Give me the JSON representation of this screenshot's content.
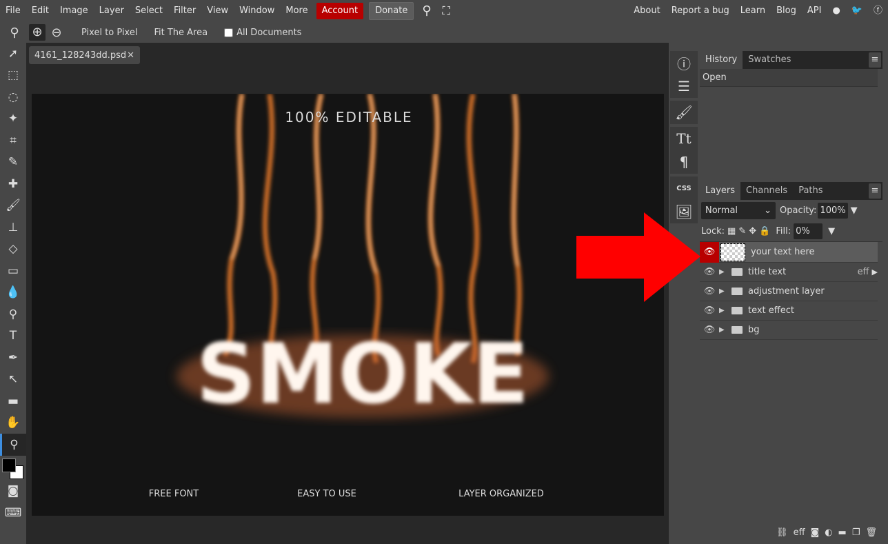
{
  "menu": {
    "items": [
      "File",
      "Edit",
      "Image",
      "Layer",
      "Select",
      "Filter",
      "View",
      "Window",
      "More"
    ],
    "account": "Account",
    "donate": "Donate",
    "right": [
      "About",
      "Report a bug",
      "Learn",
      "Blog",
      "API"
    ],
    "social_icons": [
      "reddit-icon",
      "twitter-icon",
      "facebook-icon"
    ]
  },
  "options": {
    "pixel_to_pixel": "Pixel to Pixel",
    "fit_area": "Fit The Area",
    "all_documents": "All Documents",
    "all_documents_checked": false
  },
  "document": {
    "tab": "4161_128243dd.psd",
    "close": "✕"
  },
  "canvas": {
    "headline": "100% EDITABLE",
    "main_text": "SMOKE",
    "features": [
      "FREE FONT",
      "EASY TO USE",
      "LAYER ORGANIZED"
    ]
  },
  "history": {
    "tabs": [
      "History",
      "Swatches"
    ],
    "items": [
      "Open"
    ]
  },
  "layers": {
    "tabs": [
      "Layers",
      "Channels",
      "Paths"
    ],
    "blend_mode": "Normal",
    "opacity_label": "Opacity:",
    "opacity": "100%",
    "lock_label": "Lock:",
    "fill_label": "Fill:",
    "fill": "0%",
    "items": [
      {
        "name": "your text here",
        "selected": true
      },
      {
        "name": "title text",
        "fx": "eff"
      },
      {
        "name": "adjustment layer"
      },
      {
        "name": "text effect"
      },
      {
        "name": "bg"
      }
    ],
    "footer_fx": "eff"
  },
  "iconcol": {
    "css": "CSS"
  },
  "colors": {
    "accent_red": "#b80000",
    "arrow": "#ff0000"
  }
}
